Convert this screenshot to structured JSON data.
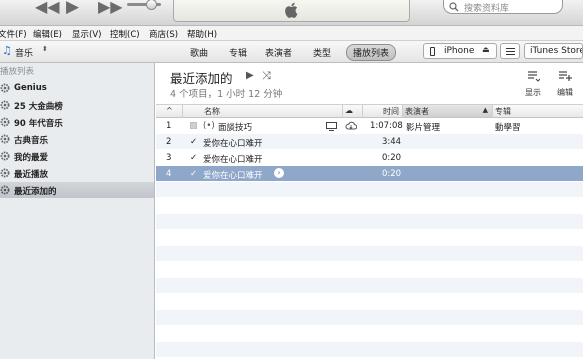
{
  "search": {
    "placeholder": "搜索资料库"
  },
  "menu": [
    "文件(F)",
    "编辑(E)",
    "显示(V)",
    "控制(C)",
    "商店(S)",
    "帮助(H)"
  ],
  "navbar": {
    "library": "音乐",
    "tabs": [
      "歌曲",
      "专辑",
      "表演者",
      "类型",
      "播放列表"
    ],
    "active_tab": "播放列表",
    "device": "iPhone",
    "store": "iTunes Store"
  },
  "sidebar": {
    "header": "播放列表",
    "items": [
      "Genius",
      "25 大金曲榜",
      "90 年代音乐",
      "古典音乐",
      "我的最爱",
      "最近播放",
      "最近添加的"
    ],
    "selected": "最近添加的"
  },
  "playlist": {
    "title": "最近添加的",
    "subtitle": "4 个项目，1 小时 12 分钟",
    "actions": {
      "show": "显示",
      "edit": "编辑"
    }
  },
  "table": {
    "headers": {
      "name": "名称",
      "time": "时间",
      "artist": "表演者",
      "album": "专辑"
    },
    "rows": [
      {
        "num": "1",
        "checked": false,
        "name": "面談技巧",
        "time": "1:07:08",
        "artist": "影片管理",
        "album": "動學習"
      },
      {
        "num": "2",
        "checked": true,
        "name": "爱你在心口难开",
        "time": "3:44",
        "artist": "",
        "album": ""
      },
      {
        "num": "3",
        "checked": true,
        "name": "爱你在心口难开",
        "time": "0:20",
        "artist": "",
        "album": ""
      },
      {
        "num": "4",
        "checked": true,
        "name": "爱你在心口难开",
        "time": "0:20",
        "artist": "",
        "album": ""
      }
    ],
    "selected_row": 3
  },
  "colors": {
    "selection": "#8fa7c9",
    "sidebar_bg": "#e9ecef",
    "row_stripe": "#f1f4f8"
  }
}
